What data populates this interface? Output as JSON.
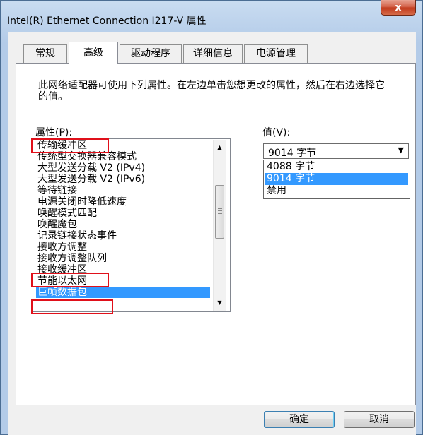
{
  "window": {
    "title": "Intel(R) Ethernet Connection I217-V 属性",
    "close_label": "x"
  },
  "tabs": [
    {
      "label": "常规",
      "active": false
    },
    {
      "label": "高级",
      "active": true
    },
    {
      "label": "驱动程序",
      "active": false
    },
    {
      "label": "详细信息",
      "active": false
    },
    {
      "label": "电源管理",
      "active": false
    }
  ],
  "description": "此网络适配器可使用下列属性。在左边单击您想更改的属性，然后在右边选择它的值。",
  "property": {
    "label": "属性(P):",
    "items": [
      "传输缓冲区",
      "传统型交换器兼容模式",
      "大型发送分载 V2 (IPv4)",
      "大型发送分载 V2 (IPv6)",
      "等待链接",
      "电源关闭时降低速度",
      "唤醒模式匹配",
      "唤醒魔包",
      "记录链接状态事件",
      "接收方调整",
      "接收方调整队列",
      "接收缓冲区",
      "节能以太网",
      "巨帧数据包"
    ],
    "selected_index": 13
  },
  "value": {
    "label": "值(V):",
    "selected": "9014 字节",
    "options": [
      "4088 字节",
      "9014 字节",
      "禁用"
    ],
    "highlighted_index": 1
  },
  "buttons": {
    "ok": "确定",
    "cancel": "取消"
  },
  "colors": {
    "selection": "#3399ff",
    "annotation": "#e0101a"
  }
}
